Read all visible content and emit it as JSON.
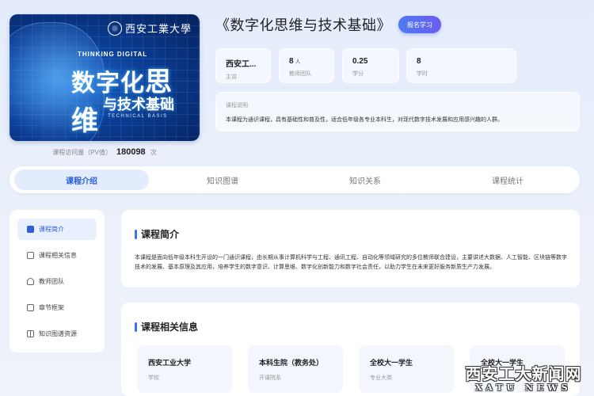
{
  "cover": {
    "logo_text": "西安工業大學",
    "en_top": "THINKING  DIGITAL",
    "title_a": "数字化",
    "title_b": "思维",
    "title_c": "与技术基础",
    "en_bottom": "TECHNICAL   BASIS"
  },
  "pv": {
    "label": "课程访问量（PV值）",
    "value": "180098",
    "unit": "次"
  },
  "course": {
    "title": "《数字化思维与技术基础》",
    "enroll_label": "报名学习"
  },
  "stats": [
    {
      "value": "西安工...",
      "unit": "",
      "label": "主讲"
    },
    {
      "value": "8",
      "unit": "人",
      "label": "教师团队"
    },
    {
      "value": "0.25",
      "unit": "",
      "label": "学分"
    },
    {
      "value": "8",
      "unit": "",
      "label": "学时"
    }
  ],
  "description": {
    "label": "课程说明",
    "text": "本课程为通识课程，具有基础性和普及性，适合低年级各专业本科生，对现代数字技术发展和应用感兴趣的人群。"
  },
  "tabs": [
    {
      "label": "课程介绍",
      "active": true
    },
    {
      "label": "知识图谱",
      "active": false
    },
    {
      "label": "知识关系",
      "active": false
    },
    {
      "label": "课程统计",
      "active": false
    }
  ],
  "sidenav": [
    {
      "label": "课程简介",
      "icon": "doc-icon",
      "active": true
    },
    {
      "label": "课程相关信息",
      "icon": "info-icon",
      "active": false
    },
    {
      "label": "教师团队",
      "icon": "user-icon",
      "active": false
    },
    {
      "label": "章节框架",
      "icon": "outline-icon",
      "active": false
    },
    {
      "label": "知识图谱资源",
      "icon": "grid-icon",
      "active": false
    }
  ],
  "intro": {
    "title": "课程简介",
    "text": "本课程是面向低年级本科生开设的一门通识课程，由长期从事计算机科学与工程、通讯工程、自动化等领域研究的多位教师联合建设，主要讲述大数据、人工智能、区块链等数字技术的发展、基本原理及其应用，培养学生的数字意识、计算思维、数字化创新能力和数字社会责任，以助力学生在未来更好服务新质生产力发展。"
  },
  "related": {
    "title": "课程相关信息",
    "items": [
      {
        "value": "西安工业大学",
        "label": "学校"
      },
      {
        "value": "本科生院（教务处）",
        "label": "开课院系"
      },
      {
        "value": "全校大一学生",
        "label": "专业大类"
      },
      {
        "value": "全校大一学生",
        "label": ""
      }
    ]
  },
  "watermark": {
    "cn": "西安工大新闻网",
    "en": "XATU NEWS"
  },
  "colors": {
    "accent": "#2d5fd8",
    "enroll_start": "#4d7bf3",
    "enroll_end": "#6c5cf0"
  }
}
